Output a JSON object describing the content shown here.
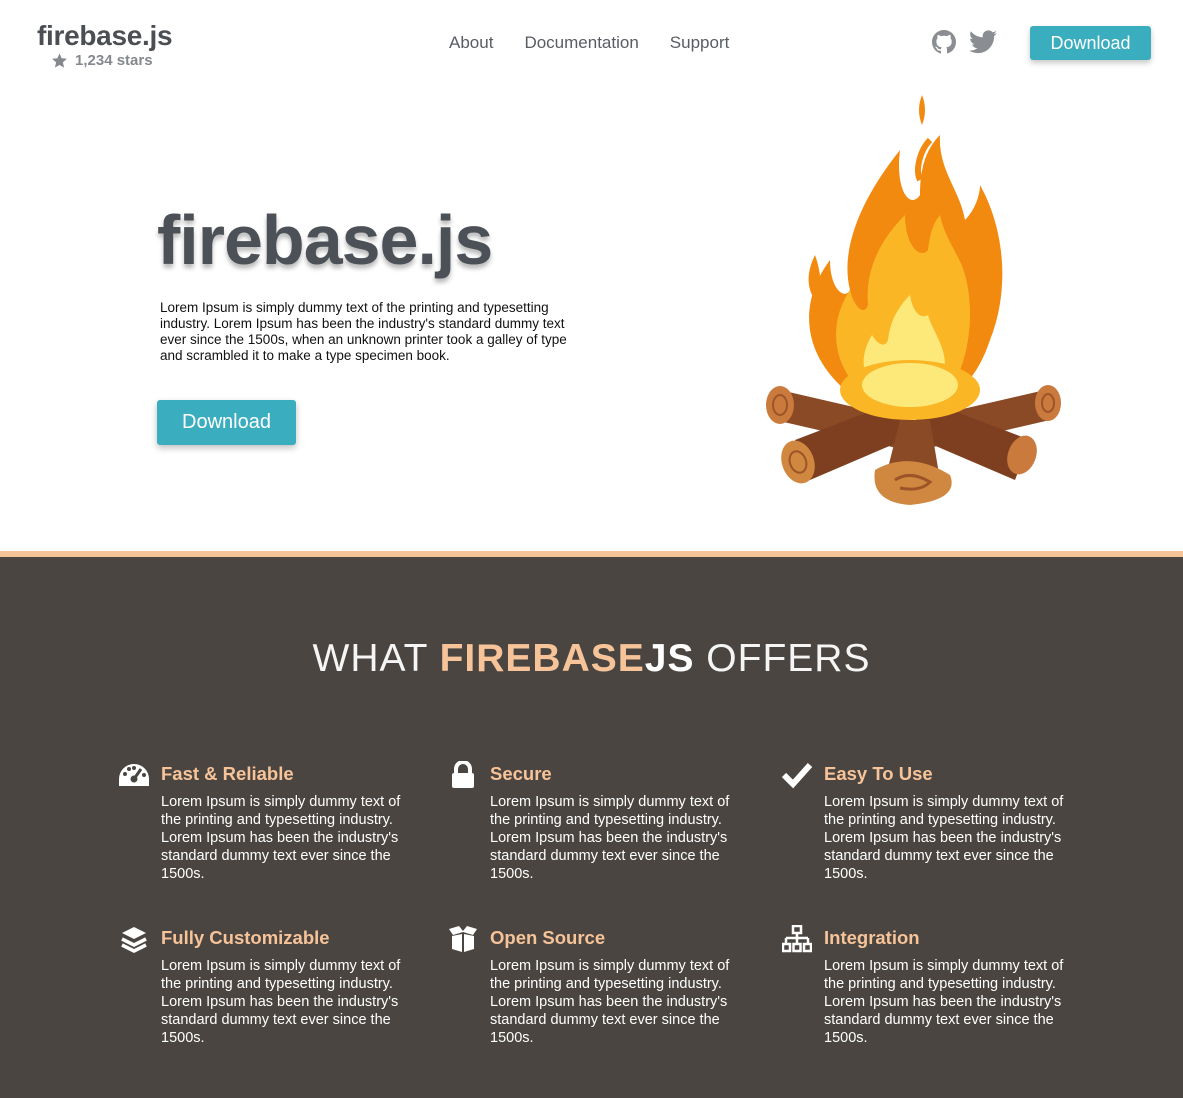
{
  "header": {
    "logo": "firebase.js",
    "stars": "1,234 stars",
    "nav": [
      "About",
      "Documentation",
      "Support"
    ],
    "download_label": "Download"
  },
  "hero": {
    "title": "firebase.js",
    "text": "Lorem Ipsum is simply dummy text of the printing and typesetting industry. Lorem Ipsum has been the industry's standard dummy text ever since the 1500s, when an unknown printer took a galley of type and scrambled it to make a type specimen book.",
    "download_label": "Download"
  },
  "features": {
    "title_prefix": "WHAT ",
    "title_brand": "FIREBASE",
    "title_js": "JS",
    "title_suffix": " OFFERS",
    "items": [
      {
        "icon": "dashboard-icon",
        "title": "Fast & Reliable",
        "text": "Lorem Ipsum is simply dummy text of the printing and typesetting industry. Lorem Ipsum has been the industry's standard dummy text ever since the 1500s."
      },
      {
        "icon": "lock-icon",
        "title": "Secure",
        "text": "Lorem Ipsum is simply dummy text of the printing and typesetting industry. Lorem Ipsum has been the industry's standard dummy text ever since the 1500s."
      },
      {
        "icon": "checkmark-icon",
        "title": "Easy To Use",
        "text": "Lorem Ipsum is simply dummy text of the printing and typesetting industry. Lorem Ipsum has been the industry's standard dummy text ever since the 1500s."
      },
      {
        "icon": "layers-icon",
        "title": "Fully Customizable",
        "text": "Lorem Ipsum is simply dummy text of the printing and typesetting industry. Lorem Ipsum has been the industry's standard dummy text ever since the 1500s."
      },
      {
        "icon": "open-box-icon",
        "title": "Open Source",
        "text": "Lorem Ipsum is simply dummy text of the printing and typesetting industry. Lorem Ipsum has been the industry's standard dummy text ever since the 1500s."
      },
      {
        "icon": "network-icon",
        "title": "Integration",
        "text": "Lorem Ipsum is simply dummy text of the printing and typesetting industry. Lorem Ipsum has been the industry's standard dummy text ever since the 1500s."
      }
    ]
  },
  "colors": {
    "accent": "#3aadbf",
    "brand_peach": "#f7c399",
    "dark_bg": "#4a4540",
    "text_dark": "#4b5157"
  }
}
